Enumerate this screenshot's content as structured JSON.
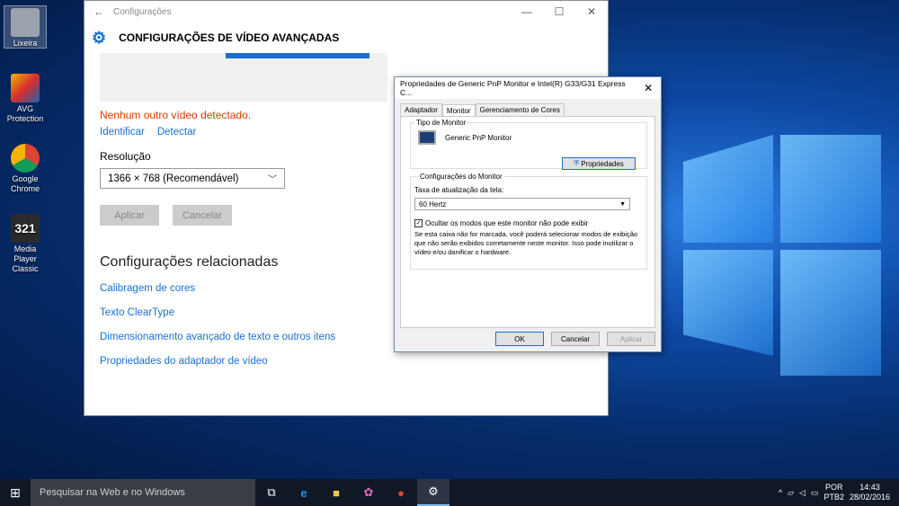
{
  "desktop": {
    "icons": [
      {
        "label": "Lixeira",
        "icon": "recycle-bin-icon",
        "color": "#9aa3ad"
      },
      {
        "label": "AVG Protection",
        "icon": "avg-icon",
        "color": "#1e63b6"
      },
      {
        "label": "Google Chrome",
        "icon": "chrome-icon",
        "color": "#db4437"
      },
      {
        "label": "Media Player Classic",
        "icon": "media-player-icon",
        "color": "#2a2a2a"
      }
    ]
  },
  "settings": {
    "window_title": "Configurações",
    "page_title": "CONFIGURAÇÕES DE VÍDEO AVANÇADAS",
    "no_display_msg": "Nenhum outro vídeo detectado.",
    "identify": "Identificar",
    "detect": "Detectar",
    "resolution_label": "Resolução",
    "resolution_value": "1366 × 768 (Recomendável)",
    "apply": "Aplicar",
    "cancel": "Cancelar",
    "related_title": "Configurações relacionadas",
    "related_links": [
      "Calibragem de cores",
      "Texto ClearType",
      "Dimensionamento avançado de texto e outros itens",
      "Propriedades do adaptador de vídeo"
    ]
  },
  "dialog": {
    "title": "Propriedades de Generic PnP Monitor e Intel(R) G33/G31 Express C...",
    "tabs": [
      "Adaptador",
      "Monitor",
      "Gerenciamento de Cores"
    ],
    "active_tab": "Monitor",
    "monitor_type_group": "Tipo de Monitor",
    "monitor_name": "Generic PnP Monitor",
    "properties_button": "Propriedades",
    "monitor_settings_group": "Configurações do Monitor",
    "refresh_label": "Taxa de atualização da tela:",
    "refresh_value": "60 Hertz",
    "hide_modes_label": "Ocultar os modos que este monitor não pode exibir",
    "hide_modes_checked": true,
    "warning_text": "Se esta caixa não for marcada, você poderá selecionar modos de exibição que não serão exibidos corretamente neste monitor. Isso pode inutilizar o vídeo e/ou danificar o hardware.",
    "ok": "OK",
    "cancel": "Cancelar",
    "apply": "Aplicar"
  },
  "taskbar": {
    "search_placeholder": "Pesquisar na Web e no Windows",
    "language": "POR",
    "keyboard": "PTB2",
    "time": "14:43",
    "date": "28/02/2016"
  },
  "colors": {
    "accent": "#1a6fd0",
    "error": "#d83b01"
  }
}
